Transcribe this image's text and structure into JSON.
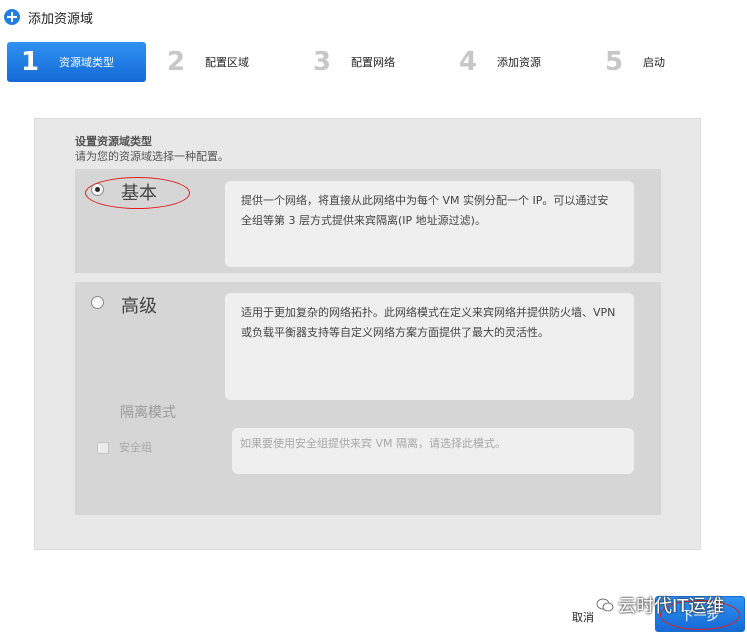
{
  "header": {
    "title": "添加资源域"
  },
  "steps": [
    {
      "number": "1",
      "label": "资源域类型",
      "active": true
    },
    {
      "number": "2",
      "label": "配置区域",
      "active": false
    },
    {
      "number": "3",
      "label": "配置网络",
      "active": false
    },
    {
      "number": "4",
      "label": "添加资源",
      "active": false
    },
    {
      "number": "5",
      "label": "启动",
      "active": false
    }
  ],
  "panel": {
    "title": "设置资源域类型",
    "subtitle": "请为您的资源域选择一种配置。",
    "options": {
      "basic": {
        "label": "基本",
        "selected": true,
        "description": "提供一个网络，将直接从此网络中为每个 VM 实例分配一个 IP。可以通过安全组等第 3 层方式提供来宾隔离(IP 地址源过滤)。"
      },
      "advanced": {
        "label": "高级",
        "selected": false,
        "description": "适用于更加复杂的网络拓扑。此网络模式在定义来宾网络并提供防火墙、VPN 或负载平衡器支持等自定义网络方案方面提供了最大的灵活性。",
        "isolation": {
          "label": "隔离模式",
          "security_group_label": "安全组",
          "security_group_checked": false,
          "security_group_description": "如果要使用安全组提供来宾 VM 隔离，请选择此模式。"
        }
      }
    }
  },
  "footer": {
    "cancel_label": "取消",
    "next_label": "下一步",
    "watermark": "云时代IT运维"
  },
  "colors": {
    "accent": "#1f7fe0",
    "annotation": "#e02020"
  }
}
